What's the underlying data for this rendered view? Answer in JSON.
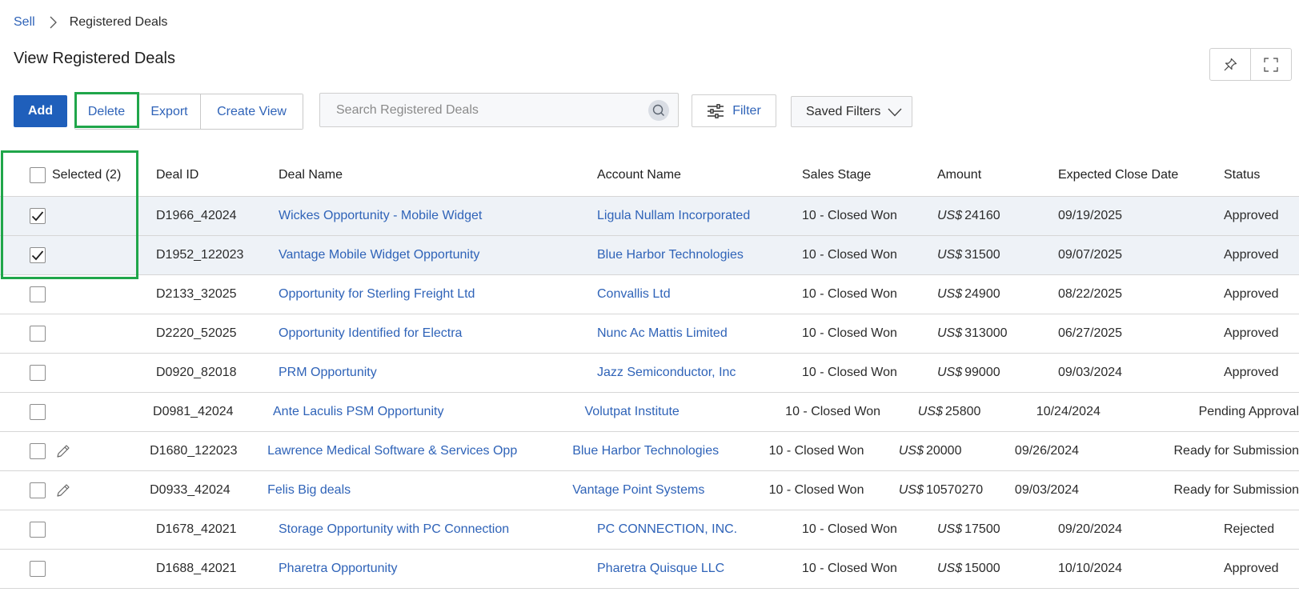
{
  "breadcrumb": {
    "parent": "Sell",
    "current": "Registered Deals"
  },
  "page_title": "View Registered Deals",
  "toolbar": {
    "add_label": "Add",
    "delete_label": "Delete",
    "export_label": "Export",
    "create_view_label": "Create View",
    "search_placeholder": "Search Registered Deals",
    "filter_label": "Filter",
    "saved_filters_label": "Saved Filters"
  },
  "table": {
    "selected_label": "Selected (2)",
    "columns": {
      "deal_id": "Deal ID",
      "deal_name": "Deal Name",
      "account_name": "Account Name",
      "sales_stage": "Sales Stage",
      "amount": "Amount",
      "close_date": "Expected Close Date",
      "status": "Status"
    },
    "rows": [
      {
        "checked": true,
        "editable": false,
        "id": "D1966_42024",
        "name": "Wickes Opportunity - Mobile Widget",
        "account": "Ligula Nullam Incorporated",
        "stage": "10 - Closed Won",
        "currency": "US$",
        "amount": "24160",
        "date": "09/19/2025",
        "status": "Approved"
      },
      {
        "checked": true,
        "editable": false,
        "id": "D1952_122023",
        "name": "Vantage Mobile Widget Opportunity",
        "account": "Blue Harbor Technologies",
        "stage": "10 - Closed Won",
        "currency": "US$",
        "amount": "31500",
        "date": "09/07/2025",
        "status": "Approved"
      },
      {
        "checked": false,
        "editable": false,
        "id": "D2133_32025",
        "name": "Opportunity for Sterling Freight Ltd",
        "account": "Convallis Ltd",
        "stage": "10 - Closed Won",
        "currency": "US$",
        "amount": "24900",
        "date": "08/22/2025",
        "status": "Approved"
      },
      {
        "checked": false,
        "editable": false,
        "id": "D2220_52025",
        "name": "Opportunity Identified for Electra",
        "account": "Nunc Ac Mattis Limited",
        "stage": "10 - Closed Won",
        "currency": "US$",
        "amount": "313000",
        "date": "06/27/2025",
        "status": "Approved"
      },
      {
        "checked": false,
        "editable": false,
        "id": "D0920_82018",
        "name": "PRM Opportunity",
        "account": "Jazz Semiconductor, Inc",
        "stage": "10 - Closed Won",
        "currency": "US$",
        "amount": "99000",
        "date": "09/03/2024",
        "status": "Approved"
      },
      {
        "checked": false,
        "editable": false,
        "id": "D0981_42024",
        "name": "Ante Laculis PSM Opportunity",
        "account": "Volutpat Institute",
        "stage": "10 - Closed Won",
        "currency": "US$",
        "amount": "25800",
        "date": "10/24/2024",
        "status": "Pending Approval"
      },
      {
        "checked": false,
        "editable": true,
        "id": "D1680_122023",
        "name": "Lawrence Medical Software & Services Opp",
        "account": "Blue Harbor Technologies",
        "stage": "10 - Closed Won",
        "currency": "US$",
        "amount": "20000",
        "date": "09/26/2024",
        "status": "Ready for Submission"
      },
      {
        "checked": false,
        "editable": true,
        "id": "D0933_42024",
        "name": "Felis Big deals",
        "account": "Vantage Point Systems",
        "stage": "10 - Closed Won",
        "currency": "US$",
        "amount": "10570270",
        "date": "09/03/2024",
        "status": "Ready for Submission"
      },
      {
        "checked": false,
        "editable": false,
        "id": "D1678_42021",
        "name": "Storage Opportunity with PC Connection",
        "account": "PC CONNECTION, INC.",
        "stage": "10 - Closed Won",
        "currency": "US$",
        "amount": "17500",
        "date": "09/20/2024",
        "status": "Rejected"
      },
      {
        "checked": false,
        "editable": false,
        "id": "D1688_42021",
        "name": "Pharetra Opportunity",
        "account": "Pharetra Quisque LLC",
        "stage": "10 - Closed Won",
        "currency": "US$",
        "amount": "15000",
        "date": "10/10/2024",
        "status": "Approved"
      }
    ]
  },
  "icons": {
    "breadcrumb_separator": "chevron-right-icon",
    "pin": "pin-icon",
    "fullscreen": "fullscreen-icon",
    "search": "search-icon",
    "filter": "sliders-icon",
    "saved_filters": "chevron-down-icon",
    "checked": "checkmark-icon",
    "edit": "pencil-icon"
  },
  "colors": {
    "primary": "#1f5fbb",
    "link": "#2f63b8",
    "highlight": "#20a64a",
    "selected_row": "#eef2f7"
  }
}
